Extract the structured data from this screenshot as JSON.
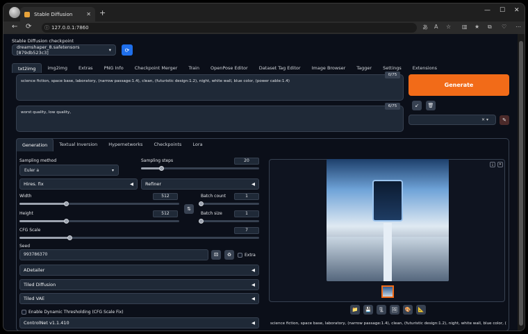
{
  "browser": {
    "tab_title": "Stable Diffusion",
    "tab_close": "✕",
    "new_tab": "+",
    "url": "127.0.0.1:7860",
    "controls": {
      "minimize": "—",
      "maximize": "☐",
      "close": "✕"
    },
    "nav": {
      "back": "←",
      "refresh": "⟳"
    }
  },
  "checkpoint": {
    "label": "Stable Diffusion checkpoint",
    "value": "dreamshaper_8.safetensors [879db523c3]",
    "refresh_icon": "⟳"
  },
  "top_tabs": [
    "txt2img",
    "img2img",
    "Extras",
    "PNG Info",
    "Checkpoint Merger",
    "Train",
    "OpenPose Editor",
    "Dataset Tag Editor",
    "Image Browser",
    "Tagger",
    "Settings",
    "Extensions"
  ],
  "prompt": {
    "positive": "science fiction, space base, laboratory, (narrow passage:1.4), clean, (futuristic design:1.2), night, white wall, blue color, (power cable:1.4)",
    "positive_tokens": "0/75",
    "negative": "worst quality, low quality,",
    "negative_tokens": "6/75"
  },
  "generate_label": "Generate",
  "style_clear": "✕ ▾",
  "sub_tabs": [
    "Generation",
    "Textual Inversion",
    "Hypernetworks",
    "Checkpoints",
    "Lora"
  ],
  "generation": {
    "sampling_method_label": "Sampling method",
    "sampling_method_value": "Euler a",
    "sampling_steps_label": "Sampling steps",
    "sampling_steps": "20",
    "hires_label": "Hires. fix",
    "refiner_label": "Refiner",
    "width_label": "Width",
    "width": "512",
    "height_label": "Height",
    "height": "512",
    "batch_count_label": "Batch count",
    "batch_count": "1",
    "batch_size_label": "Batch size",
    "batch_size": "1",
    "cfg_label": "CFG Scale",
    "cfg": "7",
    "seed_label": "Seed",
    "seed": "993786370",
    "extra_label": "Extra",
    "adetailer_label": "ADetailer",
    "tiled_diffusion_label": "Tiled Diffusion",
    "tiled_vae_label": "Tiled VAE",
    "dynamic_thresh_label": "Enable Dynamic Thresholding (CFG Scale Fix)",
    "controlnet_label": "ControlNet v1.1.410",
    "sliders": {
      "steps": 0.17,
      "width": 0.29,
      "height": 0.29,
      "batch_count": 0.0,
      "batch_size": 0.0,
      "cfg": 0.21
    }
  },
  "output": {
    "caption": "science fiction, space base, laboratory, (narrow passage:1.4), clean, (futuristic design:1.2), night, white wall, blue color, (power",
    "buttons": [
      "📁",
      "💾",
      "🗜",
      "🖼",
      "🎨",
      "📐"
    ]
  }
}
